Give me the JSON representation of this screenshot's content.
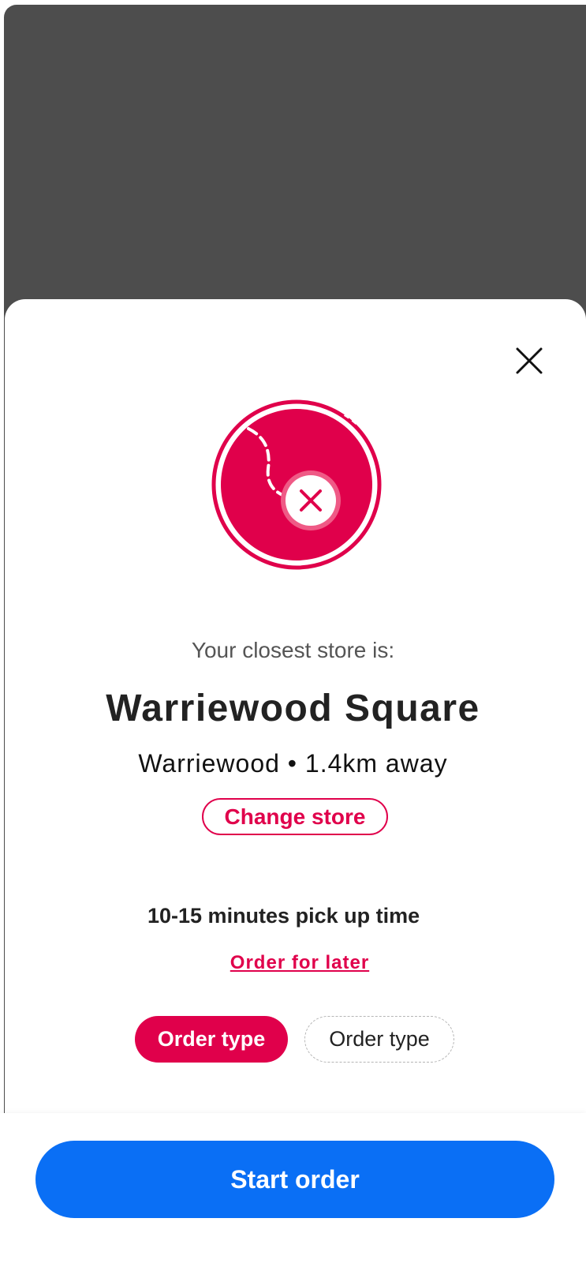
{
  "colors": {
    "accent": "#e0004b",
    "primary_button": "#0a6ff5",
    "backdrop": "#4d4d4d"
  },
  "icons": {
    "close": "close-icon",
    "hero": "store-location-icon"
  },
  "sheet": {
    "intro": "Your closest store is:",
    "store_name": "Warriewood Square",
    "store_meta": "Warriewood • 1.4km away",
    "change_store_label": "Change store",
    "pickup_time": "10-15 minutes pick up time",
    "order_later_label": "Order for later",
    "order_type_options": [
      {
        "label": "Order type",
        "selected": true
      },
      {
        "label": "Order type",
        "selected": false
      }
    ]
  },
  "footer": {
    "start_order_label": "Start order"
  }
}
